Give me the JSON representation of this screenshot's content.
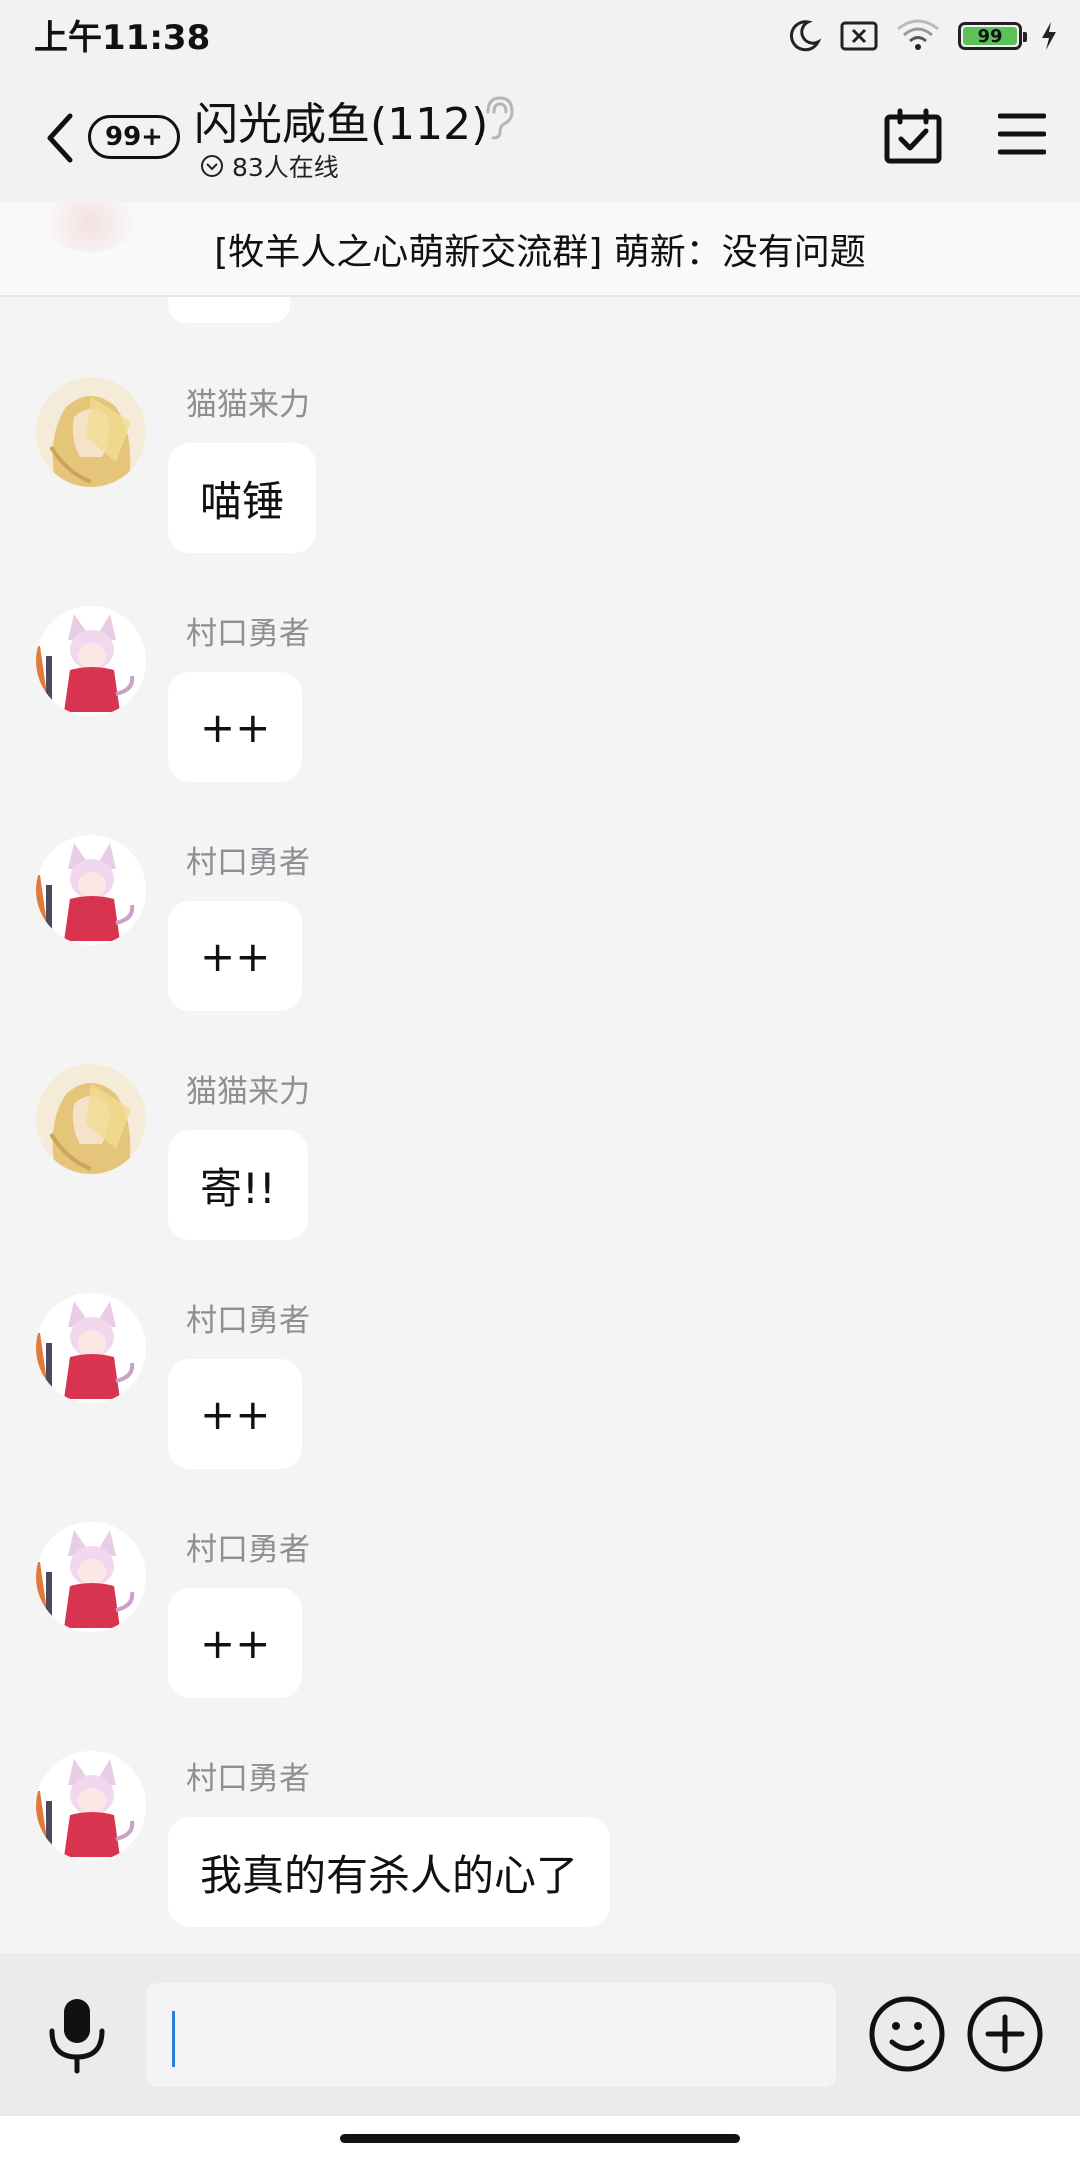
{
  "status_bar": {
    "time": "上午11:38",
    "battery": "99"
  },
  "header": {
    "unread_badge": "99+",
    "title": "闪光咸鱼(112)",
    "online": "83人在线"
  },
  "announcement": {
    "text": "[牧羊人之心萌新交流群] 萌新：没有问题"
  },
  "messages": [
    {
      "sender": "猫猫来力",
      "text": "喵锤",
      "avatar": "blonde-avatar"
    },
    {
      "sender": "村口勇者",
      "text": "++",
      "avatar": "catgirl-avatar"
    },
    {
      "sender": "村口勇者",
      "text": "++",
      "avatar": "catgirl-avatar"
    },
    {
      "sender": "猫猫来力",
      "text": "寄!!",
      "avatar": "blonde-avatar"
    },
    {
      "sender": "村口勇者",
      "text": "++",
      "avatar": "catgirl-avatar"
    },
    {
      "sender": "村口勇者",
      "text": "++",
      "avatar": "catgirl-avatar"
    },
    {
      "sender": "村口勇者",
      "text": "我真的有杀人的心了",
      "avatar": "catgirl-avatar"
    }
  ],
  "input": {
    "value": "",
    "placeholder": ""
  },
  "colors": {
    "accent": "#2a7de1",
    "battery": "#5dc15a",
    "background": "#f4f4f5"
  }
}
